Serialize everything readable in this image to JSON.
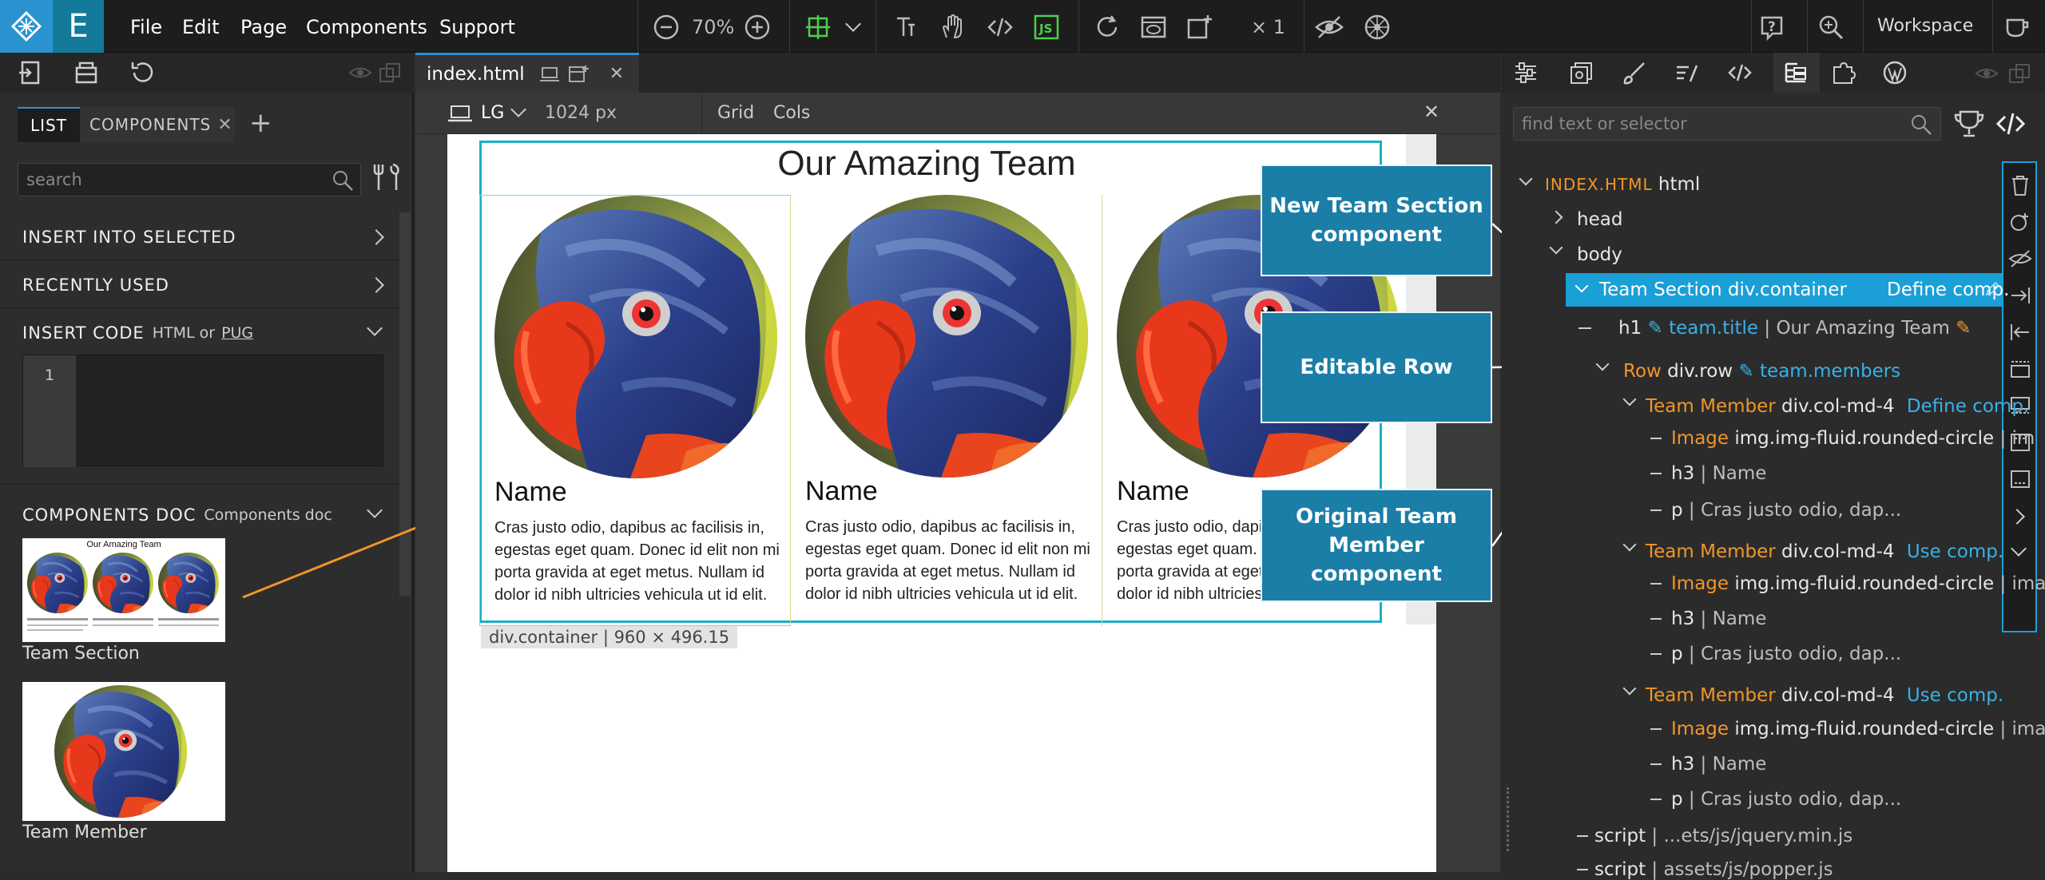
{
  "menu": {
    "file": "File",
    "edit": "Edit",
    "page": "Page",
    "components": "Components",
    "support": "Support"
  },
  "toolbar": {
    "zoom": "70%",
    "multiplier": "× 1",
    "workspace": "Workspace"
  },
  "left": {
    "tab_list": "LIST",
    "tab_components": "COMPONENTS",
    "search_placeholder": "search",
    "insert_into_selected": "INSERT INTO SELECTED",
    "recently_used": "RECENTLY USED",
    "insert_code": "INSERT CODE",
    "insert_code_hint": "HTML or",
    "insert_code_pug": "PUG",
    "line_number": "1",
    "components_doc": "COMPONENTS DOC",
    "components_doc_sub": "Components doc",
    "thumb1_title": "Our Amazing Team",
    "thumb1_label": "Team Section",
    "thumb2_label": "Team Member"
  },
  "center": {
    "tab_name": "index.html",
    "device": "LG",
    "width": "1024 px",
    "grid": "Grid",
    "cols": "Cols",
    "page_title": "Our Amazing Team",
    "members": [
      {
        "name": "Name",
        "text": "Cras justo odio, dapibus ac facilisis in, egestas eget quam. Donec id elit non mi porta gravida at eget metus. Nullam id dolor id nibh ultricies vehicula ut id elit."
      },
      {
        "name": "Name",
        "text": "Cras justo odio, dapibus ac facilisis in, egestas eget quam. Donec id elit non mi porta gravida at eget metus. Nullam id dolor id nibh ultricies vehicula ut id elit."
      },
      {
        "name": "Name",
        "text": "Cras justo odio, dapibus ac facilisis in, egestas eget quam. Donec id elit non mi porta gravida at eget metus. Nullam id dolor id nibh ultricies vehicula ut id elit."
      }
    ],
    "selection_info": "div.container | 960 × 496.15"
  },
  "callouts": {
    "new_team": "New Team Section component",
    "editable_row": "Editable Row",
    "original_member": "Original Team Member component"
  },
  "right": {
    "search_placeholder": "find text or selector",
    "tree": {
      "root_tag": "INDEX.HTML",
      "root_el": "html",
      "head": "head",
      "body": "body",
      "team_section": "Team Section",
      "team_section_sel": "div.container",
      "define_comp": "Define comp.",
      "h1": "h1",
      "h1_bind": "team.title",
      "h1_text": "| Our Amazing Team",
      "row": "Row",
      "row_sel": "div.row",
      "row_bind": "team.members",
      "member": "Team Member",
      "member_sel": "div.col-md-4",
      "use_comp": "Use comp.",
      "image": "Image",
      "image_sel": "img.img-fluid.rounded-circle",
      "image_tail1": "| im",
      "image_tail2": "| images",
      "h3": "h3",
      "h3_text": "| Name",
      "p": "p",
      "p_text": "| Cras justo odio, dap...",
      "script": "script",
      "script1": "| ...ets/js/jquery.min.js",
      "script2": "| assets/js/popper.js"
    }
  },
  "colors": {
    "accent": "#2a93cf",
    "orange": "#f0962a",
    "selection": "#1a9fd6",
    "callout": "#1a7ea7"
  }
}
